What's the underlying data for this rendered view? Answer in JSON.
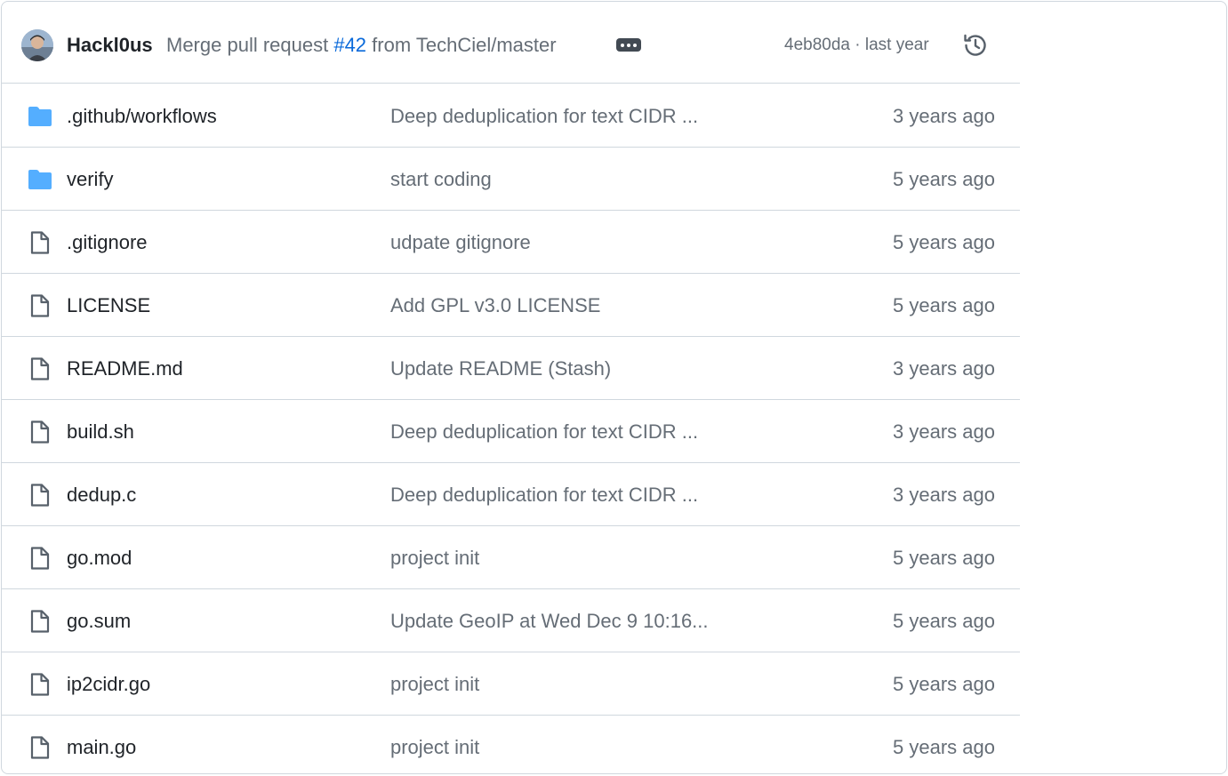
{
  "commit": {
    "author": "Hackl0us",
    "message_prefix": "Merge pull request ",
    "pr_link": "#42",
    "message_suffix": " from TechCiel/master",
    "sha_time": "4eb80da · last year",
    "avatar_icon": "avatar",
    "more_icon": "ellipsis-icon",
    "history_icon": "history-icon"
  },
  "colors": {
    "folder": "#54aeff",
    "link": "#0969da",
    "muted": "#656d76",
    "border": "#d0d7de"
  },
  "files": [
    {
      "type": "folder",
      "name": ".github/workflows",
      "message": "Deep deduplication for text CIDR ...",
      "age": "3 years ago"
    },
    {
      "type": "folder",
      "name": "verify",
      "message": "start coding",
      "age": "5 years ago"
    },
    {
      "type": "file",
      "name": ".gitignore",
      "message": "udpate gitignore",
      "age": "5 years ago"
    },
    {
      "type": "file",
      "name": "LICENSE",
      "message": "Add GPL v3.0 LICENSE",
      "age": "5 years ago"
    },
    {
      "type": "file",
      "name": "README.md",
      "message": "Update README (Stash)",
      "age": "3 years ago"
    },
    {
      "type": "file",
      "name": "build.sh",
      "message": "Deep deduplication for text CIDR ...",
      "age": "3 years ago"
    },
    {
      "type": "file",
      "name": "dedup.c",
      "message": "Deep deduplication for text CIDR ...",
      "age": "3 years ago"
    },
    {
      "type": "file",
      "name": "go.mod",
      "message": "project init",
      "age": "5 years ago"
    },
    {
      "type": "file",
      "name": "go.sum",
      "message": "Update GeoIP at Wed Dec 9 10:16...",
      "age": "5 years ago"
    },
    {
      "type": "file",
      "name": "ip2cidr.go",
      "message": "project init",
      "age": "5 years ago"
    },
    {
      "type": "file",
      "name": "main.go",
      "message": "project init",
      "age": "5 years ago"
    }
  ]
}
